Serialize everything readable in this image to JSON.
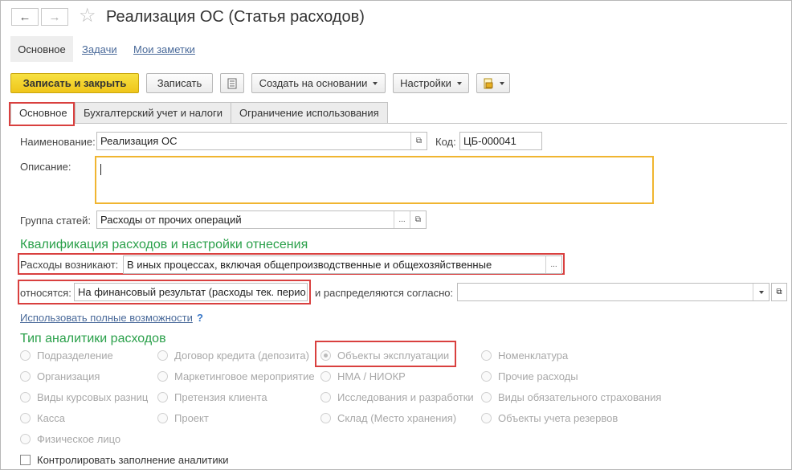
{
  "header": {
    "back_icon": "arrow-left-icon",
    "forward_icon": "arrow-right-icon",
    "favorite_icon": "star-icon",
    "title": "Реализация ОС (Статья расходов)"
  },
  "nav": {
    "tabs": [
      {
        "label": "Основное"
      },
      {
        "label": "Задачи"
      },
      {
        "label": "Мои заметки"
      }
    ]
  },
  "toolbar": {
    "save_close": "Записать и закрыть",
    "save": "Записать",
    "create_based": "Создать на основании",
    "settings": "Настройки"
  },
  "form_tabs": [
    {
      "label": "Основное"
    },
    {
      "label": "Бухгалтерский учет и налоги"
    },
    {
      "label": "Ограничение использования"
    }
  ],
  "fields": {
    "name_label": "Наименование:",
    "name_value": "Реализация ОС",
    "code_label": "Код:",
    "code_value": "ЦБ-000041",
    "description_label": "Описание:",
    "description_value": "",
    "group_label": "Группа статей:",
    "group_value": "Расходы от прочих операций"
  },
  "qualification": {
    "heading": "Квалификация расходов и настройки отнесения",
    "arise_label": "Расходы возникают:",
    "arise_value": "В иных процессах, включая общепроизводственные и общехозяйственные",
    "relate_label": "относятся:",
    "relate_value": "На финансовый результат (расходы тек. перио,",
    "distribute_label": "и распределяются согласно:",
    "distribute_value": "",
    "full_features_link": "Использовать полные возможности",
    "help": "?"
  },
  "analytics": {
    "heading": "Тип аналитики расходов",
    "columns": [
      [
        "Подразделение",
        "Организация",
        "Виды курсовых разниц",
        "Касса",
        "Физическое лицо"
      ],
      [
        "Договор кредита (депозита)",
        "Маркетинговое мероприятие",
        "Претензия клиента",
        "Проект"
      ],
      [
        "Объекты эксплуатации",
        "НМА / НИОКР",
        "Исследования и разработки",
        "Склад (Место хранения)"
      ],
      [
        "Номенклатура",
        "Прочие расходы",
        "Виды обязательного страхования",
        "Объекты учета резервов"
      ]
    ],
    "selected": "Объекты эксплуатации",
    "control_checkbox": "Контролировать заполнение аналитики",
    "control_checked": false
  },
  "colors": {
    "accent_yellow": "#f2cf2a",
    "section_green": "#2aa04a",
    "highlight_red": "#d9403f",
    "focus_orange": "#f0b530"
  }
}
